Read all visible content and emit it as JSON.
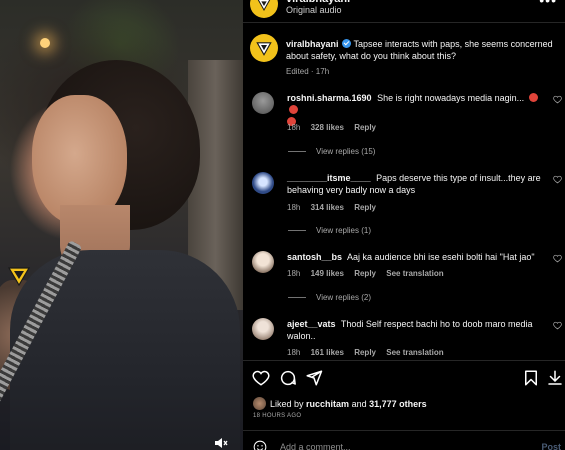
{
  "post": {
    "account": "viralbhayani",
    "audio": "Original audio",
    "more_icon": "more-icon"
  },
  "caption": {
    "username": "viralbhayani",
    "text": "Tapsee interacts with paps, she seems concerned about safety, what do you think about this?",
    "meta": "Edited · 17h"
  },
  "comments": [
    {
      "username": "roshni.sharma.1690",
      "text": "She is right nowadays media nagin... ",
      "age": "18h",
      "likes": "328 likes",
      "reply": "Reply",
      "translation": "",
      "view_replies": "View replies (15)",
      "avatar_color": "#6e6e6e"
    },
    {
      "username": "________itsme____",
      "text": "Paps deserve this type of insult...they are behaving very badly now a days",
      "age": "18h",
      "likes": "314 likes",
      "reply": "Reply",
      "translation": "",
      "view_replies": "View replies (1)",
      "avatar_color": "#2f4a86"
    },
    {
      "username": "santosh__bs",
      "text": "Aaj ka audience bhi ise esehi bolti hai \"Hat jao\"",
      "age": "18h",
      "likes": "149 likes",
      "reply": "Reply",
      "translation": "See translation",
      "view_replies": "View replies (2)",
      "avatar_color": "#d9c7b8"
    },
    {
      "username": "ajeet__vats",
      "text": "Thodi Self respect bachi ho to doob maro media walon..",
      "age": "18h",
      "likes": "161 likes",
      "reply": "Reply",
      "translation": "See translation",
      "view_replies": "",
      "avatar_color": "#c9b6a8"
    }
  ],
  "liked_by": {
    "prefix": "Liked by",
    "user": "rucchitam",
    "and": "and",
    "count": "31,777 others"
  },
  "posted_ago": "18 HOURS AGO",
  "add_comment": {
    "placeholder": "Add a comment...",
    "post_label": "Post"
  },
  "colors": {
    "brand_yellow": "#f2c21b",
    "verified_blue": "#3897f0",
    "muted": "#a8a8a8",
    "background": "#000000"
  }
}
